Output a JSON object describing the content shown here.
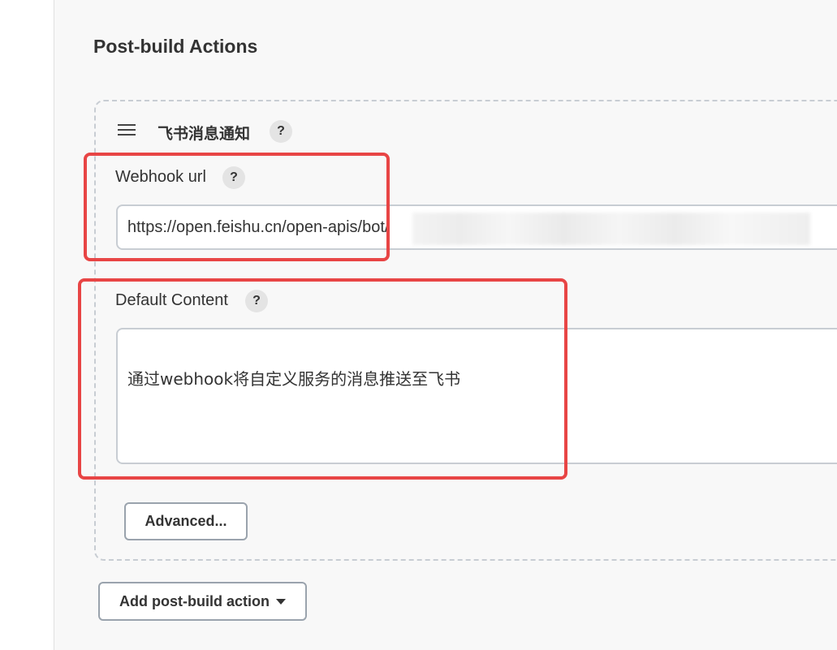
{
  "section": {
    "title": "Post-build Actions"
  },
  "block": {
    "title": "飞书消息通知",
    "help": "?",
    "webhook": {
      "label": "Webhook url",
      "help": "?",
      "value": "https://open.feishu.cn/open-apis/bot/"
    },
    "content": {
      "label": "Default Content",
      "help": "?",
      "value": "通过webhook将自定义服务的消息推送至飞书"
    },
    "advanced_label": "Advanced..."
  },
  "add_action_label": "Add post-build action",
  "colors": {
    "highlight": "#e84545",
    "border": "#c8cdd3",
    "background": "#f8f8f8"
  }
}
